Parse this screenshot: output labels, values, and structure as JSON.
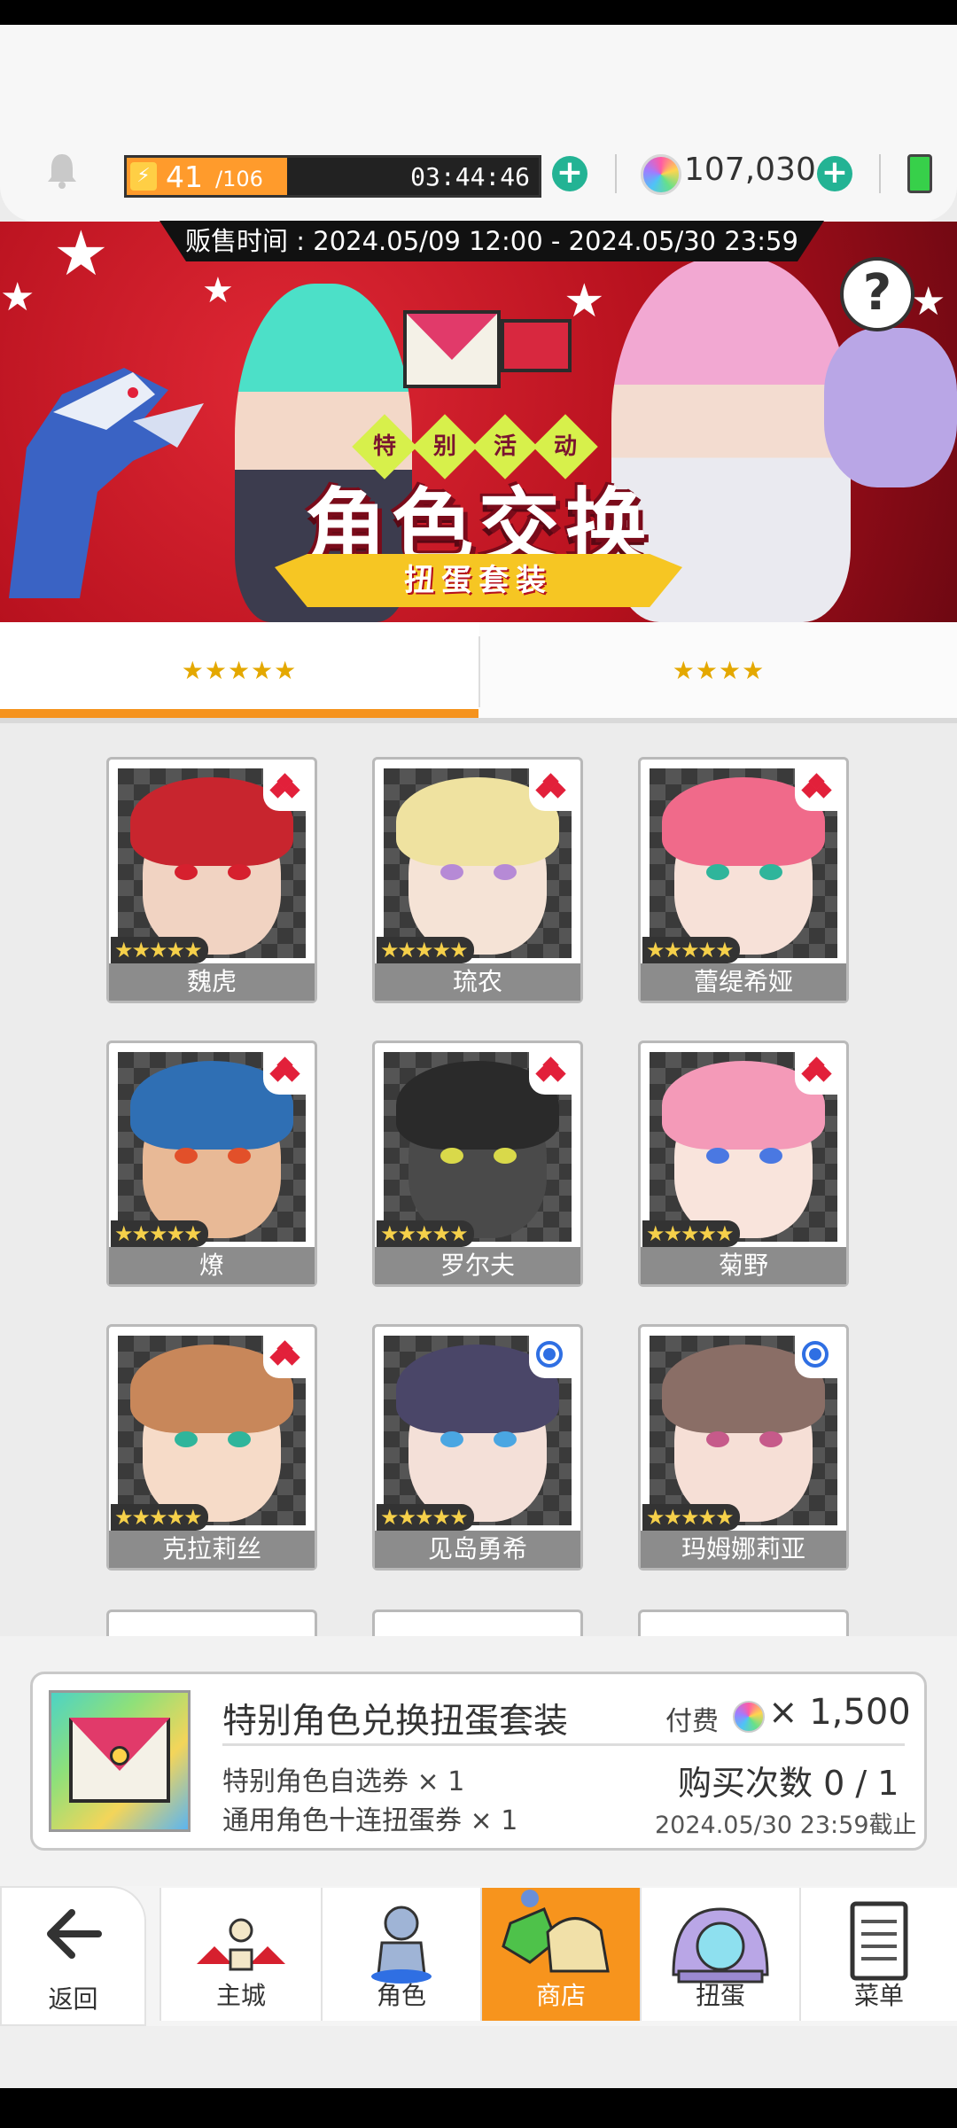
{
  "header": {
    "stamina_current": "41",
    "stamina_max": "/106",
    "stamina_fraction": 0.39,
    "stamina_timer": "03:44:46",
    "gems": "107,030"
  },
  "banner": {
    "sale_period": "贩售时间 : 2024.05/09 12:00 - 2024.05/30 23:59",
    "tag_chars": [
      "特",
      "别",
      "活",
      "动"
    ],
    "title": "角色交换",
    "ribbon": "扭蛋套装",
    "help": "?"
  },
  "tabs": [
    {
      "label": "★★★★★",
      "active": true
    },
    {
      "label": "★★★★",
      "active": false
    }
  ],
  "characters": [
    {
      "name": "魏虎",
      "stars": "★★★★★",
      "rarity_mark": "diamond"
    },
    {
      "name": "琉农",
      "stars": "★★★★★",
      "rarity_mark": "diamond"
    },
    {
      "name": "蕾缇希娅",
      "stars": "★★★★★",
      "rarity_mark": "diamond"
    },
    {
      "name": "燎",
      "stars": "★★★★★",
      "rarity_mark": "diamond"
    },
    {
      "name": "罗尔夫",
      "stars": "★★★★★",
      "rarity_mark": "diamond"
    },
    {
      "name": "菊野",
      "stars": "★★★★★",
      "rarity_mark": "diamond"
    },
    {
      "name": "克拉莉丝",
      "stars": "★★★★★",
      "rarity_mark": "diamond"
    },
    {
      "name": "见岛勇希",
      "stars": "★★★★★",
      "rarity_mark": "circle"
    },
    {
      "name": "玛姆娜莉亚",
      "stars": "★★★★★",
      "rarity_mark": "circle"
    }
  ],
  "product": {
    "name": "特别角色兑换扭蛋套装",
    "item1": "特别角色自选券 × 1",
    "item2": "通用角色十连扭蛋券 × 1",
    "price_label": "付费",
    "price_value": "× 1,500",
    "buy_count": "购买次数 0 / 1",
    "deadline": "2024.05/30 23:59截止"
  },
  "nav": {
    "back": "返回",
    "home": "主城",
    "character": "角色",
    "shop": "商店",
    "gacha": "扭蛋",
    "menu": "菜单"
  },
  "colors": {
    "accent_orange": "#f7941d",
    "plus_green": "#23b394",
    "banner_red": "#c8162a",
    "diamond_red": "#e2203a",
    "circle_blue": "#2f6fe3"
  }
}
